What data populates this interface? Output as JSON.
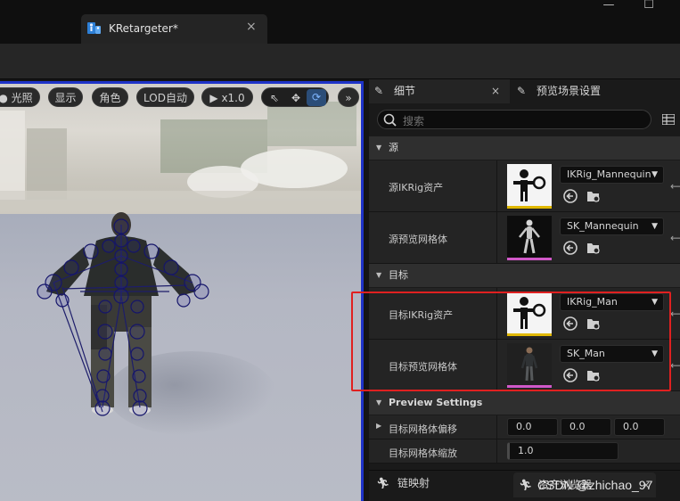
{
  "window": {
    "minimize": "—",
    "maximize": "☐"
  },
  "document_tab": {
    "title": "KRetargeter*",
    "close": "×"
  },
  "viewport": {
    "toolbar": {
      "lighting": "光照",
      "show": "显示",
      "character": "角色",
      "lod": "LOD自动",
      "speed": "x1.0",
      "more": "»"
    }
  },
  "details_panel": {
    "tab_details": "细节",
    "tab_preview": "预览场景设置",
    "close": "×",
    "search_placeholder": "搜索",
    "sections": {
      "source": "源",
      "target": "目标",
      "preview": "Preview Settings"
    },
    "source_ikrig_label": "源IKRig资产",
    "source_ikrig_value": "IKRig_Mannequin",
    "source_mesh_label": "源预览网格体",
    "source_mesh_value": "SK_Mannequin",
    "target_ikrig_label": "目标IKRig资产",
    "target_ikrig_value": "IKRig_Man",
    "target_mesh_label": "目标预览网格体",
    "target_mesh_value": "SK_Man",
    "offset_label": "目标网格体偏移",
    "offset_x": "0.0",
    "offset_y": "0.0",
    "offset_z": "0.0",
    "scale_label": "目标网格体缩放",
    "scale_value": "1.0"
  },
  "bottom_tabs": {
    "chain_map": "链映射",
    "asset_browser": "资产浏览器",
    "close": "×"
  },
  "watermark": "CSDN @zhichao_97",
  "colors": {
    "ikrig_bar": "#e0b800",
    "mesh_bar": "#d058c8",
    "selection_border": "#1e33c8",
    "annotation": "#e02020"
  }
}
